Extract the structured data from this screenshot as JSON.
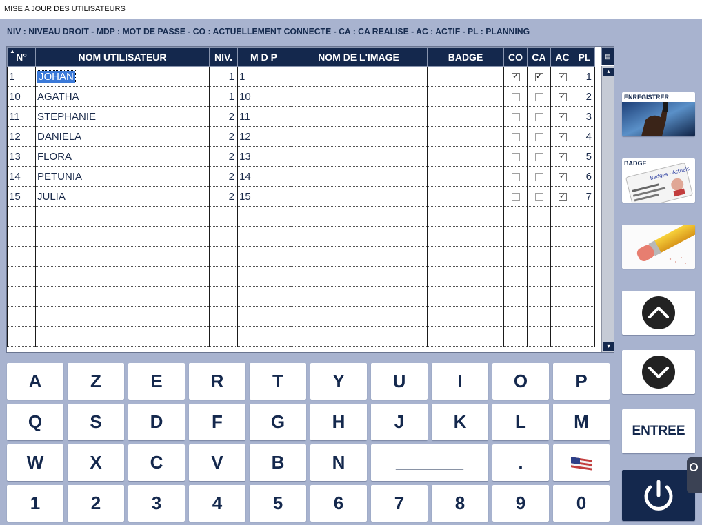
{
  "window": {
    "title": "MISE A JOUR DES UTILISATEURS"
  },
  "legend": "NIV : NIVEAU DROIT   -   MDP : MOT DE PASSE   -   CO : ACTUELLEMENT CONNECTE   -   CA : CA REALISE   -   AC : ACTIF   -   PL : PLANNING",
  "grid": {
    "columns": [
      "N°",
      "NOM UTILISATEUR",
      "NIV.",
      "M D P",
      "NOM DE L'IMAGE",
      "BADGE",
      "CO",
      "CA",
      "AC",
      "PL"
    ],
    "rows": [
      {
        "n": "1",
        "nom": "JOHAN",
        "niv": "1",
        "mdp": "1",
        "image": "",
        "badge": "",
        "co": true,
        "ca": true,
        "ac": true,
        "pl": "1",
        "selected": true
      },
      {
        "n": "10",
        "nom": "AGATHA",
        "niv": "1",
        "mdp": "10",
        "image": "",
        "badge": "",
        "co": false,
        "ca": false,
        "ac": true,
        "pl": "2"
      },
      {
        "n": "11",
        "nom": "STEPHANIE",
        "niv": "2",
        "mdp": "11",
        "image": "",
        "badge": "",
        "co": false,
        "ca": false,
        "ac": true,
        "pl": "3"
      },
      {
        "n": "12",
        "nom": "DANIELA",
        "niv": "2",
        "mdp": "12",
        "image": "",
        "badge": "",
        "co": false,
        "ca": false,
        "ac": true,
        "pl": "4"
      },
      {
        "n": "13",
        "nom": "FLORA",
        "niv": "2",
        "mdp": "13",
        "image": "",
        "badge": "",
        "co": false,
        "ca": false,
        "ac": true,
        "pl": "5"
      },
      {
        "n": "14",
        "nom": "PETUNIA",
        "niv": "2",
        "mdp": "14",
        "image": "",
        "badge": "",
        "co": false,
        "ca": false,
        "ac": true,
        "pl": "6"
      },
      {
        "n": "15",
        "nom": "JULIA",
        "niv": "2",
        "mdp": "15",
        "image": "",
        "badge": "",
        "co": false,
        "ca": false,
        "ac": true,
        "pl": "7"
      }
    ],
    "empty_rows": 7
  },
  "keyboard": {
    "rows": [
      [
        "A",
        "Z",
        "E",
        "R",
        "T",
        "Y",
        "U",
        "I",
        "O",
        "P"
      ],
      [
        "Q",
        "S",
        "D",
        "F",
        "G",
        "H",
        "J",
        "K",
        "L",
        "M"
      ],
      [
        "W",
        "X",
        "C",
        "V",
        "B",
        "N",
        "________",
        ".",
        "flag"
      ],
      [
        "1",
        "2",
        "3",
        "4",
        "5",
        "6",
        "7",
        "8",
        "9",
        "0"
      ]
    ]
  },
  "side": {
    "save_label": "ENREGISTRER",
    "badge_label": "BADGE",
    "badge_card_text": "Badges - Actuels",
    "entree_label": "ENTREE"
  },
  "colors": {
    "navy": "#14284d",
    "background": "#a8b3cf",
    "selection": "#3a79d8"
  }
}
